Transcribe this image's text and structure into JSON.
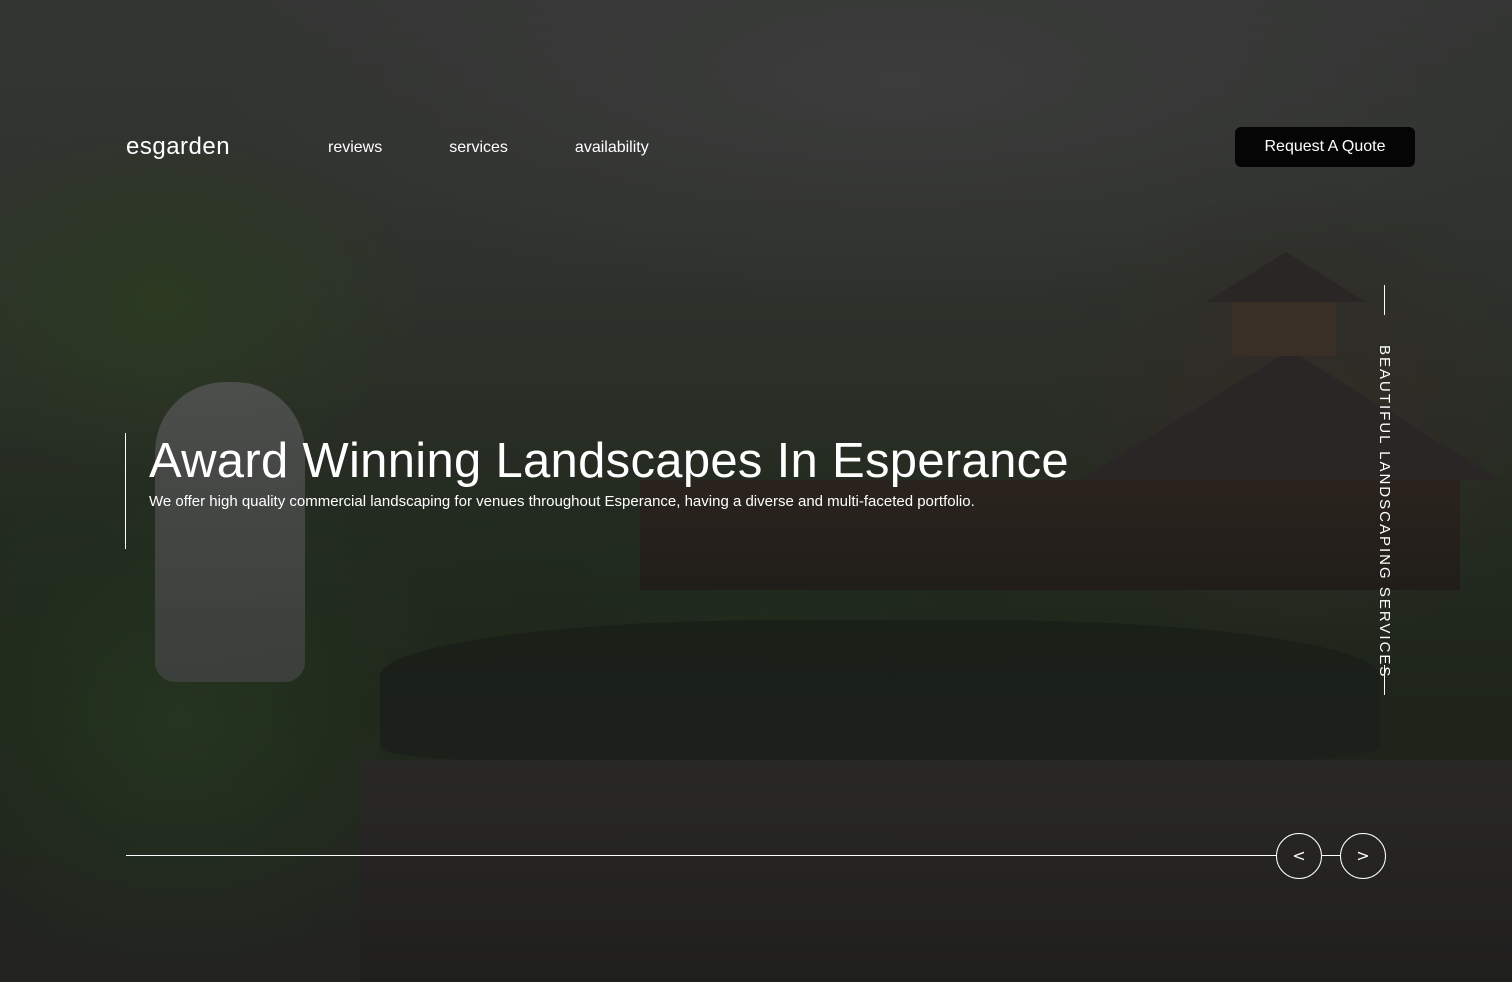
{
  "header": {
    "logo": "esgarden",
    "nav": [
      "reviews",
      "services",
      "availability"
    ],
    "cta_label": "Request A Quote"
  },
  "hero": {
    "title": "Award Winning Landscapes In Esperance",
    "subtitle": "We offer high quality commercial landscaping for venues throughout Esperance, having a diverse and multi-faceted portfolio."
  },
  "side_label": "BEAUTIFUL LANDSCAPING SERVICES",
  "slider": {
    "prev_label": "<",
    "next_label": ">"
  },
  "colors": {
    "text": "#ffffff",
    "cta_background": "#050505"
  }
}
